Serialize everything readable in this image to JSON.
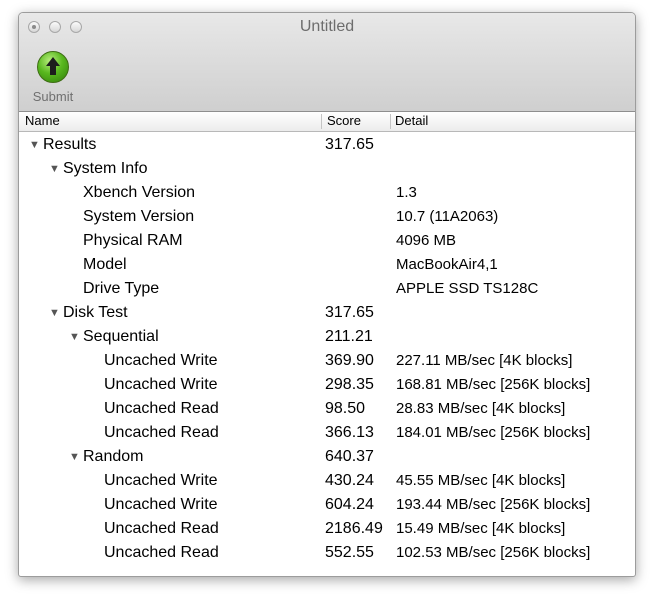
{
  "window": {
    "title": "Untitled"
  },
  "toolbar": {
    "submit_label": "Submit"
  },
  "columns": {
    "name": "Name",
    "score": "Score",
    "detail": "Detail"
  },
  "rows": [
    {
      "name": "Results",
      "score": "317.65",
      "detail": ""
    },
    {
      "name": "System Info",
      "score": "",
      "detail": ""
    },
    {
      "name": "Xbench Version",
      "score": "",
      "detail": "1.3"
    },
    {
      "name": "System Version",
      "score": "",
      "detail": "10.7 (11A2063)"
    },
    {
      "name": "Physical RAM",
      "score": "",
      "detail": "4096 MB"
    },
    {
      "name": "Model",
      "score": "",
      "detail": "MacBookAir4,1"
    },
    {
      "name": "Drive Type",
      "score": "",
      "detail": "APPLE SSD TS128C"
    },
    {
      "name": "Disk Test",
      "score": "317.65",
      "detail": ""
    },
    {
      "name": "Sequential",
      "score": "211.21",
      "detail": ""
    },
    {
      "name": "Uncached Write",
      "score": "369.90",
      "detail": "227.11 MB/sec [4K blocks]"
    },
    {
      "name": "Uncached Write",
      "score": "298.35",
      "detail": "168.81 MB/sec [256K blocks]"
    },
    {
      "name": "Uncached Read",
      "score": "98.50",
      "detail": "28.83 MB/sec [4K blocks]"
    },
    {
      "name": "Uncached Read",
      "score": "366.13",
      "detail": "184.01 MB/sec [256K blocks]"
    },
    {
      "name": "Random",
      "score": "640.37",
      "detail": ""
    },
    {
      "name": "Uncached Write",
      "score": "430.24",
      "detail": "45.55 MB/sec [4K blocks]"
    },
    {
      "name": "Uncached Write",
      "score": "604.24",
      "detail": "193.44 MB/sec [256K blocks]"
    },
    {
      "name": "Uncached Read",
      "score": "2186.49",
      "detail": "15.49 MB/sec [4K blocks]"
    },
    {
      "name": "Uncached Read",
      "score": "552.55",
      "detail": "102.53 MB/sec [256K blocks]"
    }
  ]
}
